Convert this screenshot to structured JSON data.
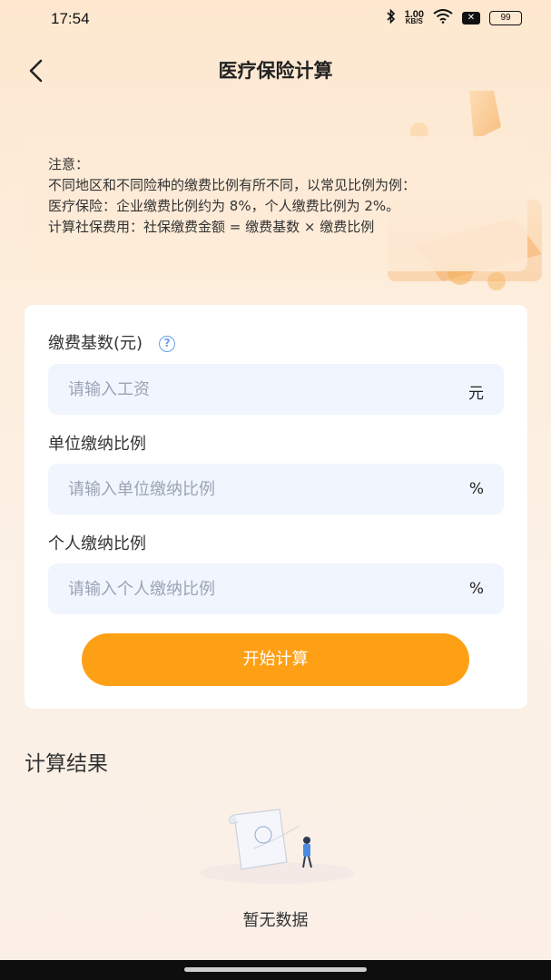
{
  "status_bar": {
    "time": "17:54",
    "net_speed_value": "1.00",
    "net_speed_unit": "KB/S",
    "battery": "99"
  },
  "header": {
    "title": "医疗保险计算",
    "back_icon": "chevron-left-icon"
  },
  "notice": {
    "line1": "注意：",
    "line2": "不同地区和不同险种的缴费比例有所不同，以常见比例为例：",
    "line3": "医疗保险：企业缴费比例约为 8%，个人缴费比例为 2%。",
    "line4": "计算社保费用：社保缴费金额 = 缴费基数 × 缴费比例"
  },
  "form": {
    "base": {
      "label": "缴费基数(元)",
      "placeholder": "请输入工资",
      "unit": "元",
      "help_icon": "question-circle-icon"
    },
    "company_rate": {
      "label": "单位缴纳比例",
      "placeholder": "请输入单位缴纳比例",
      "unit": "%"
    },
    "personal_rate": {
      "label": "个人缴纳比例",
      "placeholder": "请输入个人缴纳比例",
      "unit": "%"
    },
    "submit_label": "开始计算"
  },
  "result": {
    "title": "计算结果",
    "empty_text": "暂无数据"
  },
  "colors": {
    "accent": "#fea015",
    "input_bg": "#f1f5fd",
    "help_blue": "#6aa0e8"
  }
}
